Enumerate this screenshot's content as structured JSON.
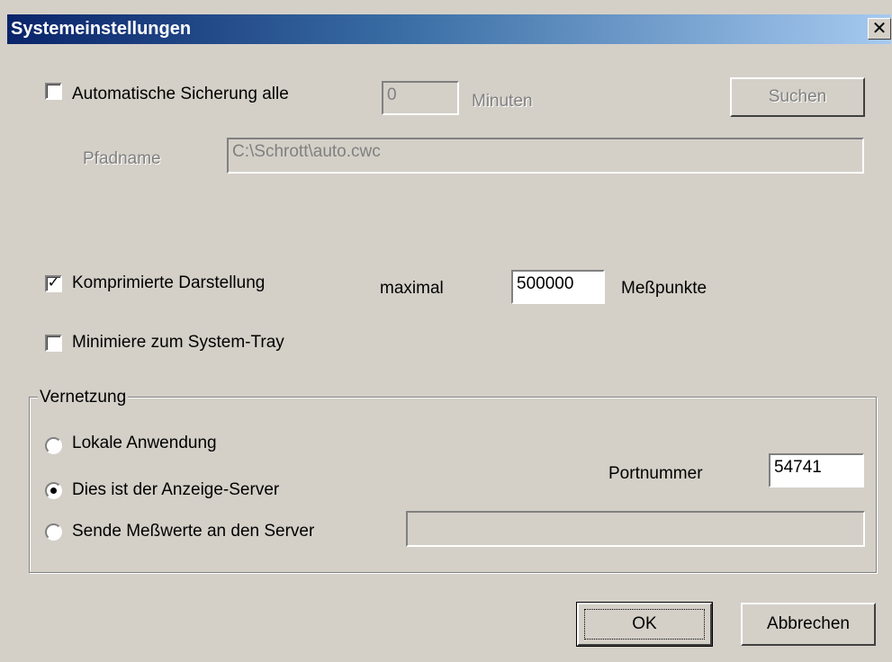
{
  "window": {
    "title": "Systemeinstellungen",
    "close_glyph": "✕"
  },
  "autosave": {
    "label": "Automatische Sicherung alle",
    "checked": false,
    "minutes_value": "0",
    "minutes_label": "Minuten",
    "search_label": "Suchen",
    "path_label": "Pfadname",
    "path_value": "C:\\Schrott\\auto.cwc"
  },
  "compressed": {
    "label": "Komprimierte Darstellung",
    "checked": true,
    "max_label": "maximal",
    "max_value": "500000",
    "unit_label": "Meßpunkte"
  },
  "tray": {
    "label": "Minimiere zum System-Tray",
    "checked": false
  },
  "network": {
    "group_label": "Vernetzung",
    "options": [
      {
        "label": "Lokale Anwendung",
        "selected": false
      },
      {
        "label": "Dies ist der Anzeige-Server",
        "selected": true
      },
      {
        "label": "Sende Meßwerte an den Server",
        "selected": false
      }
    ],
    "port_label": "Portnummer",
    "port_value": "54741",
    "server_value": ""
  },
  "buttons": {
    "ok": "OK",
    "cancel": "Abbrechen"
  },
  "colors": {
    "face": "#d4d0c8",
    "title_start": "#0a246a",
    "title_end": "#a6caf0"
  },
  "icons": {
    "check": "check-icon",
    "close": "close-icon"
  }
}
